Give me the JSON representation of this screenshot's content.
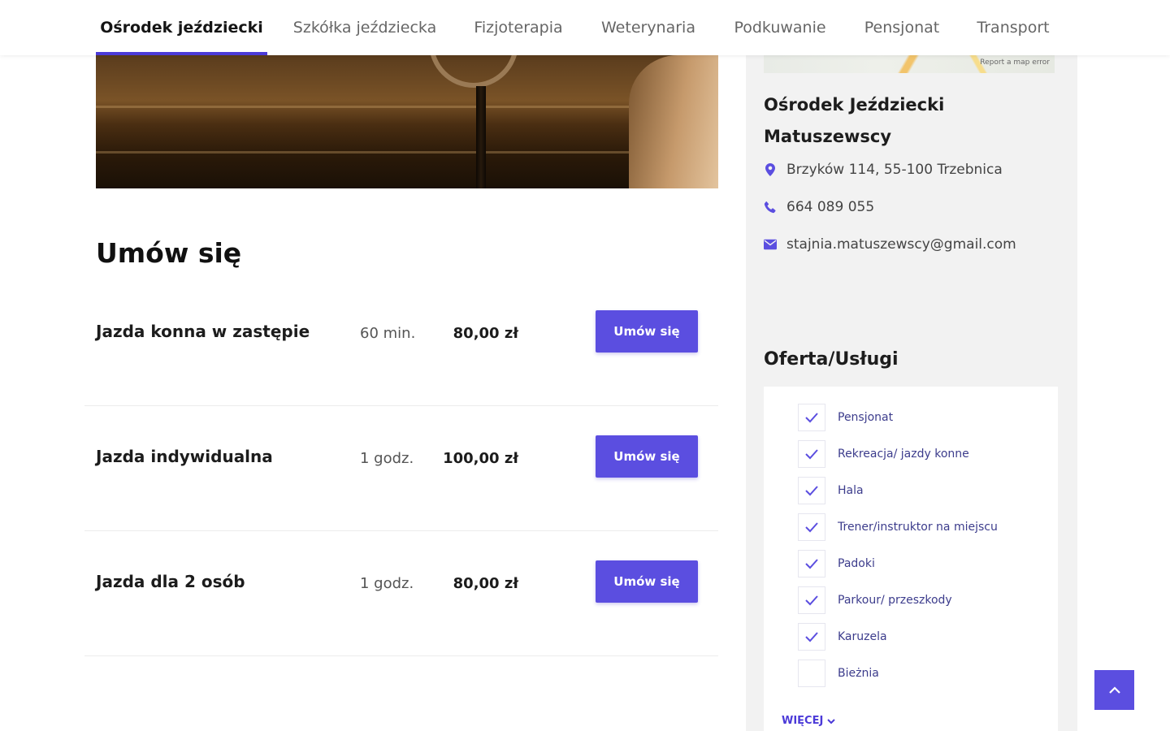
{
  "nav": {
    "tabs": [
      {
        "label": "Ośrodek jeździecki"
      },
      {
        "label": "Szkółka jeździecka"
      },
      {
        "label": "Fizjoterapia"
      },
      {
        "label": "Weterynaria"
      },
      {
        "label": "Podkuwanie"
      },
      {
        "label": "Pensjonat"
      },
      {
        "label": "Transport"
      }
    ]
  },
  "map": {
    "report_label": "Report a map error"
  },
  "section": {
    "title": "Umów się"
  },
  "services": [
    {
      "name": "Jazda konna w zastępie",
      "duration": "60 min.",
      "price": "80,00 zł",
      "button": "Umów się"
    },
    {
      "name": "Jazda indywidualna",
      "duration": "1 godz.",
      "price": "100,00 zł",
      "button": "Umów się"
    },
    {
      "name": "Jazda dla 2 osób",
      "duration": "1 godz.",
      "price": "80,00 zł",
      "button": "Umów się"
    }
  ],
  "sidebar": {
    "name": "Ośrodek Jeździecki Matuszewscy",
    "address": "Brzyków 114, 55-100 Trzebnica",
    "phone": "664 089 055",
    "email": "stajnia.matuszewscy@gmail.com",
    "offer_title": "Oferta/Usługi",
    "offers": [
      {
        "label": "Pensjonat",
        "checked": true
      },
      {
        "label": "Rekreacja/ jazdy konne",
        "checked": true
      },
      {
        "label": "Hala",
        "checked": true
      },
      {
        "label": "Trener/instruktor na miejscu",
        "checked": true
      },
      {
        "label": "Padoki",
        "checked": true
      },
      {
        "label": "Parkour/ przeszkody",
        "checked": true
      },
      {
        "label": "Karuzela",
        "checked": true
      },
      {
        "label": "Bieżnia",
        "checked": false
      }
    ],
    "more_label": "WIĘCEJ"
  },
  "colors": {
    "accent": "#5b4ee0",
    "nav_underline": "#4b3ad8",
    "sidebar_bg": "#f2f2f2"
  }
}
